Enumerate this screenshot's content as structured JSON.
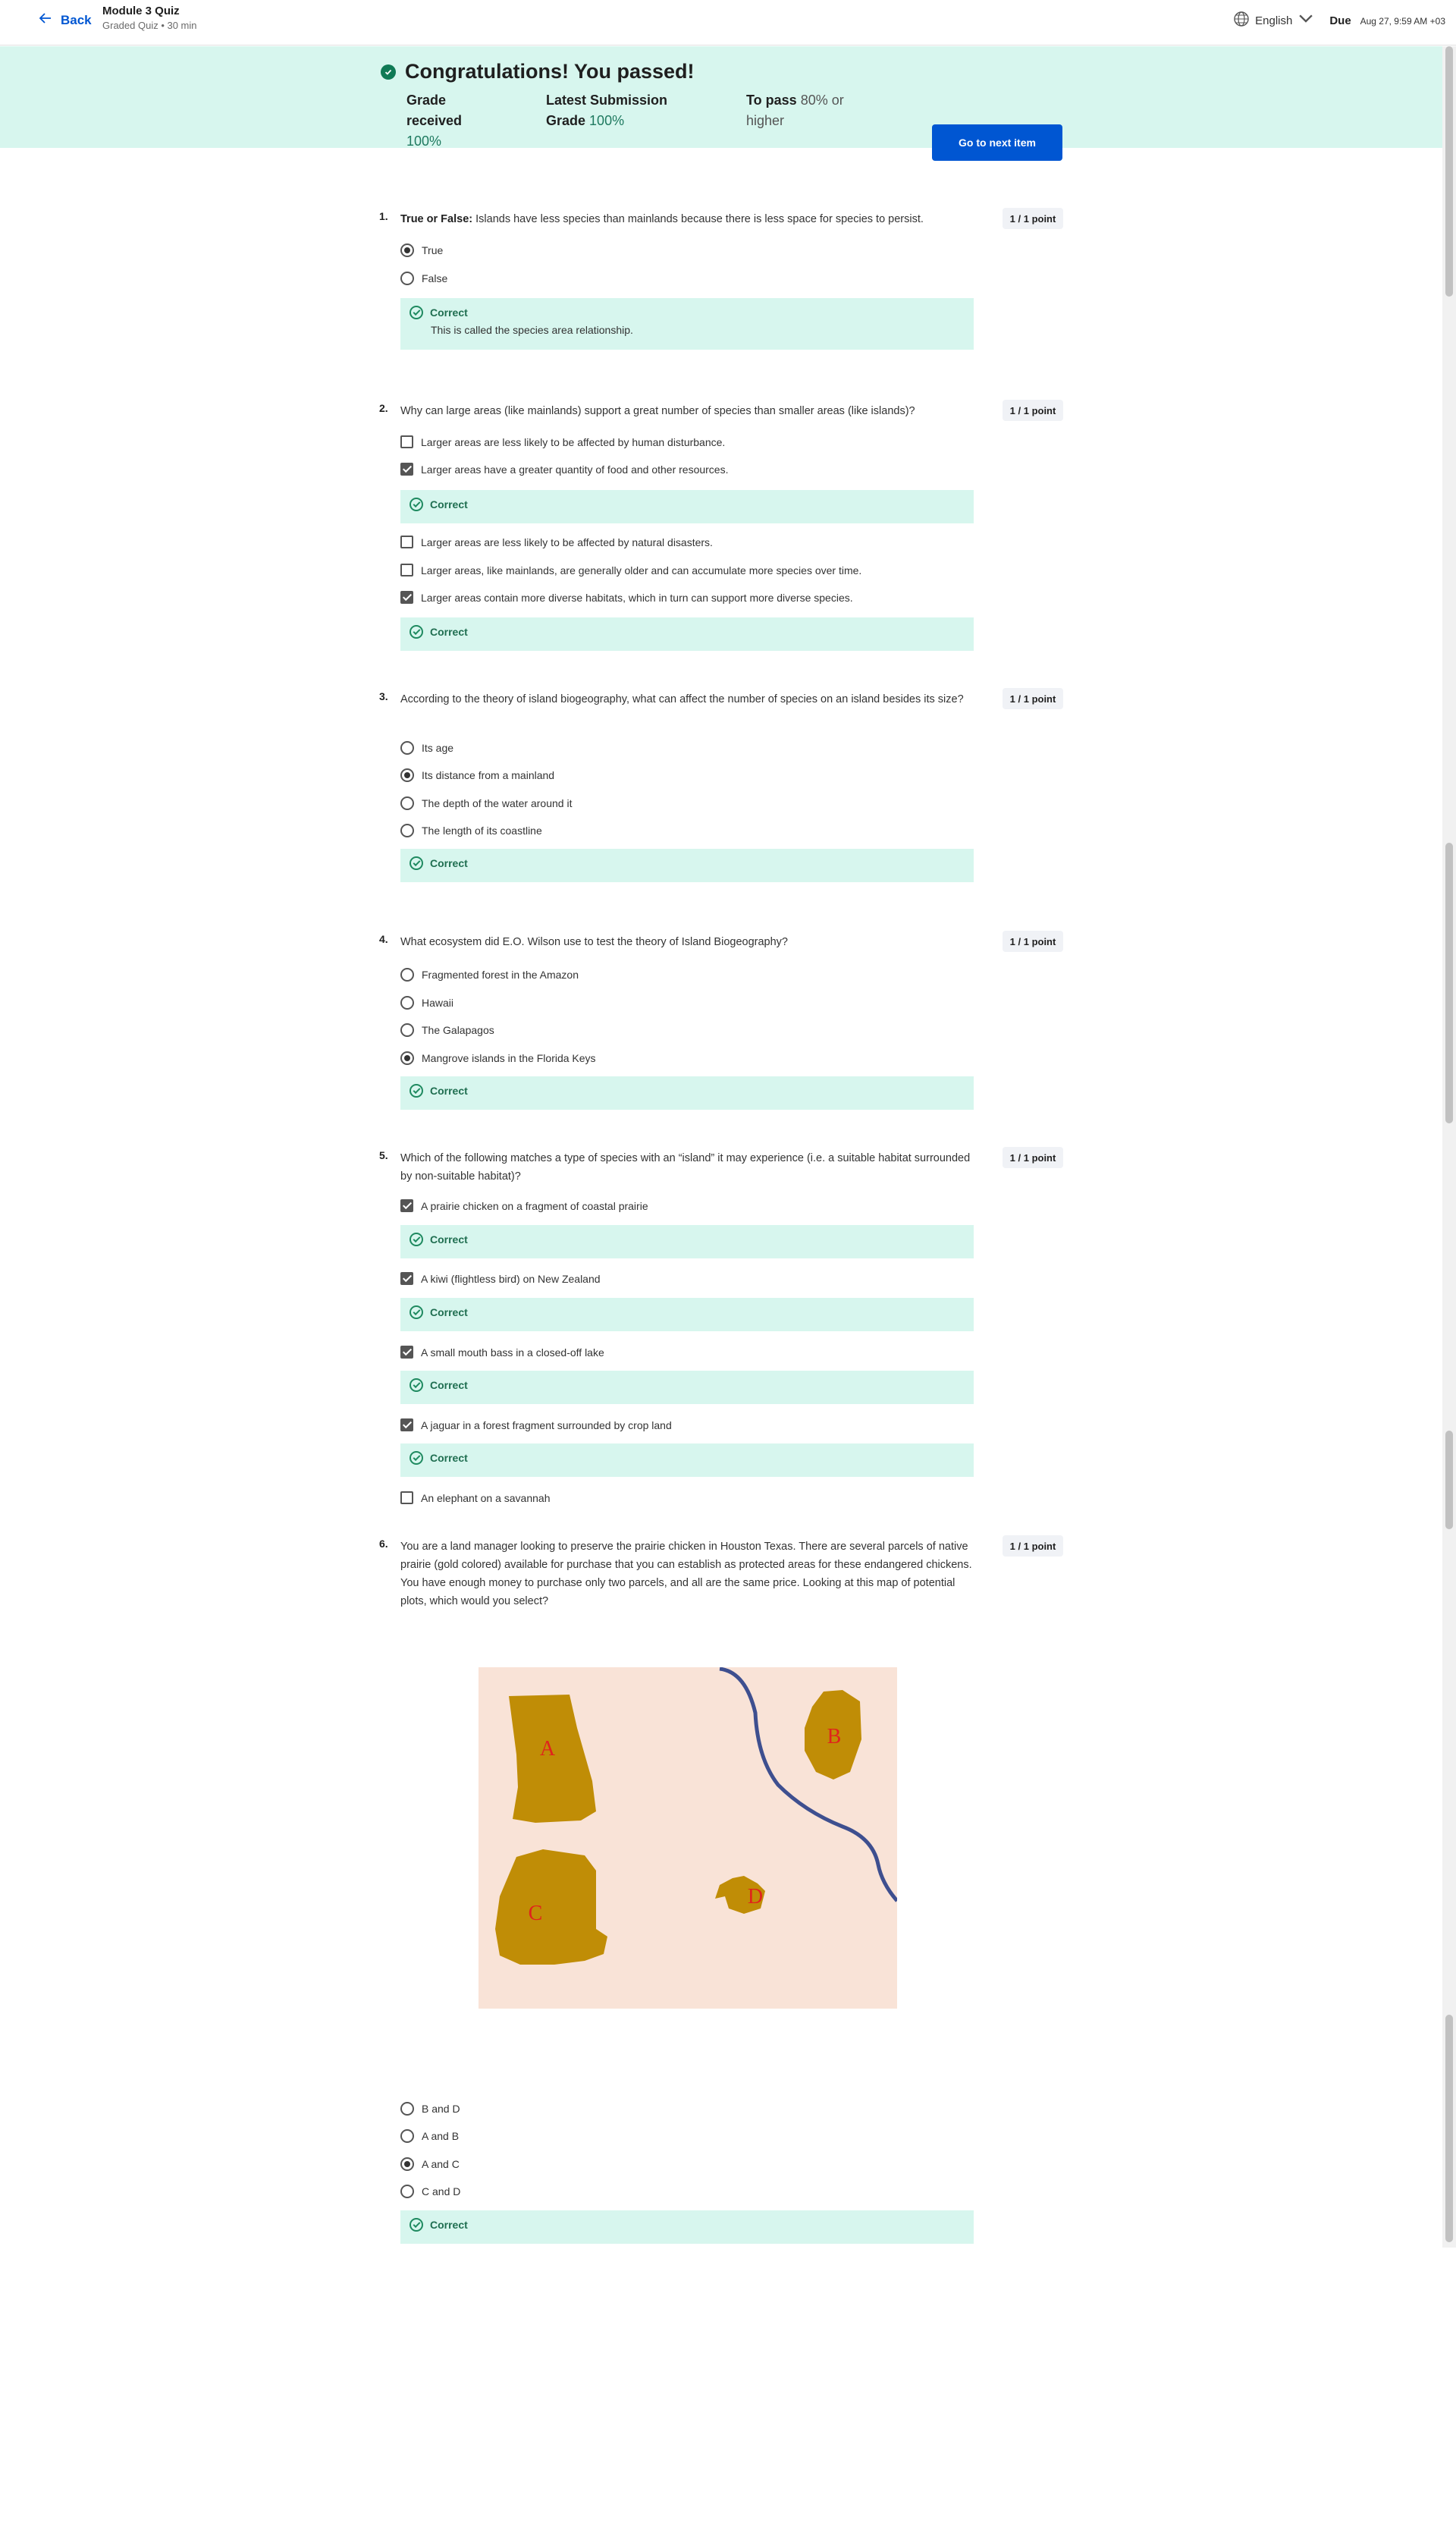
{
  "header": {
    "back_label": "Back",
    "quiz_title": "Module 3 Quiz",
    "quiz_subtitle": "Graded Quiz • 30 min",
    "language": "English",
    "due_label": "Due",
    "due_date": "Aug 27, 9:59 AM +03"
  },
  "banner": {
    "title": "Congratulations! You passed!",
    "grade_label": "Grade received",
    "grade_value": "100%",
    "latest_label": "Latest Submission Grade",
    "latest_value": "100%",
    "to_pass_label": "To pass",
    "to_pass_value": "80% or higher",
    "next_button": "Go to next item"
  },
  "feedback_correct": "Correct",
  "questions": [
    {
      "number": "1.",
      "prefix": "True or False:",
      "text": "Islands have less species than mainlands because there is less space for species to persist.",
      "points": "1 / 1 point",
      "options": [
        {
          "label": "True",
          "selected": true
        },
        {
          "label": "False",
          "selected": false
        }
      ],
      "explanation": "This is called the species area relationship."
    },
    {
      "number": "2.",
      "text": "Why can large areas (like mainlands) support a great number of species than smaller areas (like islands)?",
      "points": "1 / 1 point",
      "options": [
        {
          "label": "Larger areas are less likely to be affected by human disturbance.",
          "selected": false
        },
        {
          "label": "Larger areas have a greater quantity of food and other resources.",
          "selected": true
        },
        {
          "label": "Larger areas are less likely to be affected by natural disasters.",
          "selected": false
        },
        {
          "label": "Larger areas, like mainlands, are generally older and can accumulate more species over time.",
          "selected": false
        },
        {
          "label": "Larger areas contain more diverse habitats, which in turn can support more diverse species.",
          "selected": true
        }
      ]
    },
    {
      "number": "3.",
      "text": "According to the theory of island biogeography, what can affect the number of species on an island besides its size?",
      "points": "1 / 1 point",
      "options": [
        {
          "label": "Its age",
          "selected": false
        },
        {
          "label": "Its distance from a mainland",
          "selected": true
        },
        {
          "label": "The depth of the water around it",
          "selected": false
        },
        {
          "label": "The length of its coastline",
          "selected": false
        }
      ]
    },
    {
      "number": "4.",
      "text": "What ecosystem did E.O. Wilson use to test the theory of Island Biogeography?",
      "points": "1 / 1 point",
      "options": [
        {
          "label": "Fragmented forest in the Amazon",
          "selected": false
        },
        {
          "label": "Hawaii",
          "selected": false
        },
        {
          "label": "The Galapagos",
          "selected": false
        },
        {
          "label": "Mangrove islands in the Florida Keys",
          "selected": true
        }
      ]
    },
    {
      "number": "5.",
      "text": "Which of the following matches a type of species with an “island” it may experience (i.e. a suitable habitat surrounded by non-suitable habitat)?",
      "points": "1 / 1 point",
      "options": [
        {
          "label": "A prairie chicken on a fragment of coastal prairie",
          "selected": true
        },
        {
          "label": "A kiwi (flightless bird) on New Zealand",
          "selected": true
        },
        {
          "label": "A small mouth bass in a closed-off lake",
          "selected": true
        },
        {
          "label": "A jaguar in a forest fragment surrounded by crop land",
          "selected": true
        },
        {
          "label": "An elephant on a savannah",
          "selected": false
        }
      ]
    },
    {
      "number": "6.",
      "text": "You are a land manager looking to preserve the prairie chicken in Houston Texas. There are several parcels of native prairie (gold colored) available for purchase that you can establish as protected areas for these endangered chickens. You have enough money to purchase only two parcels, and all are the same price. Looking at this map of potential plots, which would you select?",
      "points": "1 / 1 point",
      "map_labels": [
        "A",
        "B",
        "C",
        "D"
      ],
      "options": [
        {
          "label": "B and D",
          "selected": false
        },
        {
          "label": "A and B",
          "selected": false
        },
        {
          "label": "A and C",
          "selected": true
        },
        {
          "label": "C and D",
          "selected": false
        }
      ]
    }
  ],
  "colors": {
    "accent": "#0056d2",
    "banner_bg": "#d7f6ee",
    "correct_text": "#1f6e50",
    "parcel_gold": "#c08d06",
    "parcel_label": "#e0231c",
    "map_bg": "#f9e3d7",
    "river": "#3e4f8f"
  }
}
